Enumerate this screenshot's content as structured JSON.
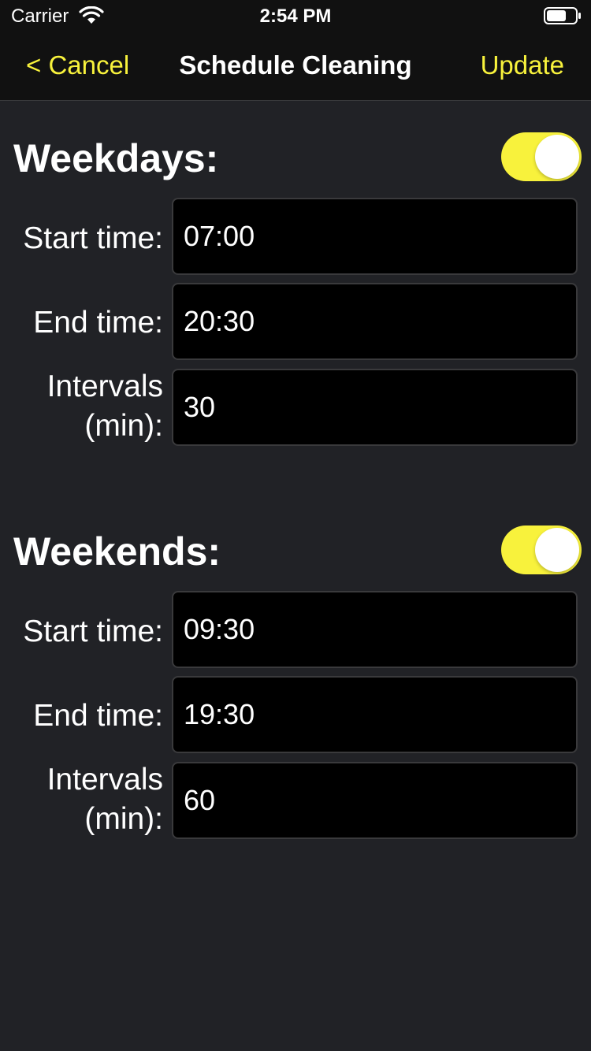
{
  "status_bar": {
    "carrier": "Carrier",
    "time": "2:54 PM",
    "icons": [
      "wifi-icon",
      "battery-icon"
    ]
  },
  "nav": {
    "cancel_label": "< Cancel",
    "title": "Schedule Cleaning",
    "update_label": "Update"
  },
  "colors": {
    "accent": "#f8f23c",
    "background": "#212226",
    "bar_background": "#111111",
    "field_background": "#000000"
  },
  "weekdays": {
    "title": "Weekdays:",
    "enabled": true,
    "start_label": "Start time:",
    "start_value": "07:00",
    "end_label": "End time:",
    "end_value": "20:30",
    "interval_label_1": "Intervals",
    "interval_label_2": "(min):",
    "interval_value": "30"
  },
  "weekends": {
    "title": "Weekends:",
    "enabled": true,
    "start_label": "Start time:",
    "start_value": "09:30",
    "end_label": "End time:",
    "end_value": "19:30",
    "interval_label_1": "Intervals",
    "interval_label_2": "(min):",
    "interval_value": "60"
  }
}
